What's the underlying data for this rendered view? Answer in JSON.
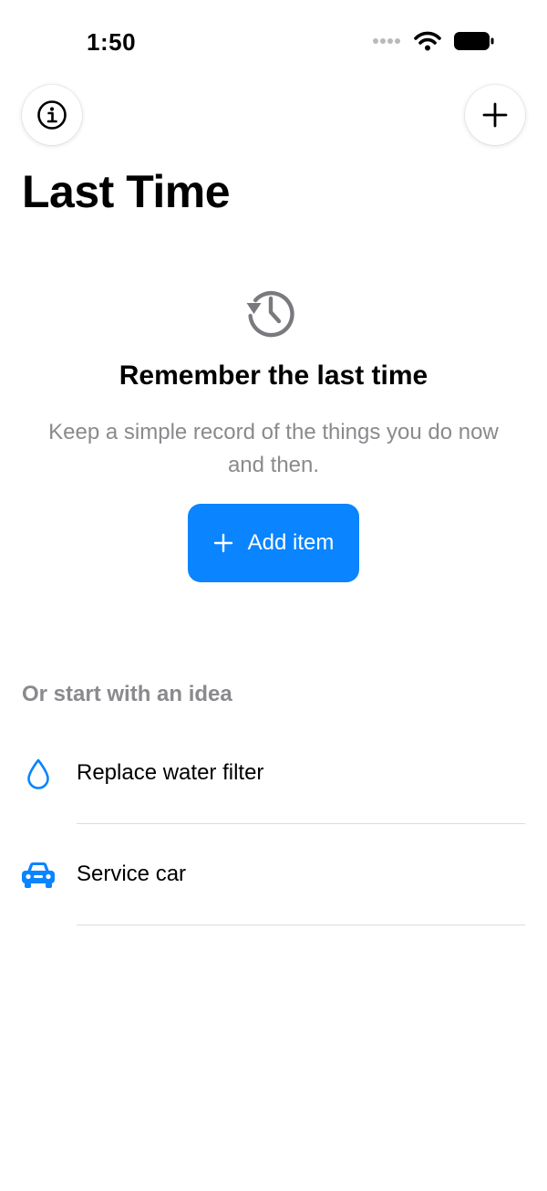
{
  "status_bar": {
    "time": "1:50",
    "icons": [
      "signal-icon",
      "wifi-icon",
      "battery-icon"
    ]
  },
  "toolbar": {
    "info_icon": "info-icon",
    "add_icon": "plus-icon"
  },
  "header": {
    "title": "Last Time"
  },
  "empty_state": {
    "icon": "history-icon",
    "heading": "Remember the last time",
    "body": "Keep a simple record of the things you do now and then.",
    "button_label": "Add item",
    "button_icon": "plus-icon"
  },
  "ideas": {
    "header": "Or start with an idea",
    "items": [
      {
        "label": "Replace water filter",
        "icon": "water-drop-icon"
      },
      {
        "label": "Service car",
        "icon": "car-icon"
      }
    ]
  },
  "colors": {
    "accent": "#0a84ff",
    "secondary_text": "#8a8a8e",
    "icon_gray": "#7a7a7e",
    "divider": "#dcdce0"
  }
}
